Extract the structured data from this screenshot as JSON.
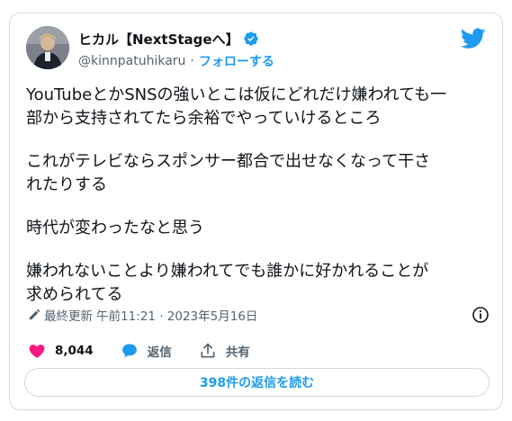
{
  "author": {
    "display_name": "ヒカル【NextStageへ】",
    "handle": "@kinnpatuhikaru",
    "separator": "·",
    "follow_label": "フォローする"
  },
  "tweet": {
    "paragraphs": [
      [
        "YouTubeとかSNSの強いとこは仮にどれだけ嫌われても一",
        "部から支持されてたら余裕でやっていけるところ"
      ],
      [
        "これがテレビならスポンサー都合で出せなくなって干さ",
        "れたりする"
      ],
      [
        "時代が変わったなと思う"
      ],
      [
        "嫌われないことより嫌われてでも誰かに好かれることが",
        "求められてる"
      ]
    ]
  },
  "meta": {
    "edited_label": "最終更新",
    "timestamp": "午前11:21 · 2023年5月16日"
  },
  "actions": {
    "like_count": "8,044",
    "reply_label": "返信",
    "share_label": "共有"
  },
  "read_replies_label": "398件の返信を読む",
  "colors": {
    "accent": "#1d9bf0",
    "like": "#f91880",
    "text": "#0f1419",
    "muted": "#536471",
    "border": "#cfd9de"
  },
  "icons": [
    "verified-badge-icon",
    "twitter-bird-icon",
    "edit-pencil-icon",
    "info-icon",
    "heart-icon",
    "reply-bubble-icon",
    "share-icon"
  ]
}
